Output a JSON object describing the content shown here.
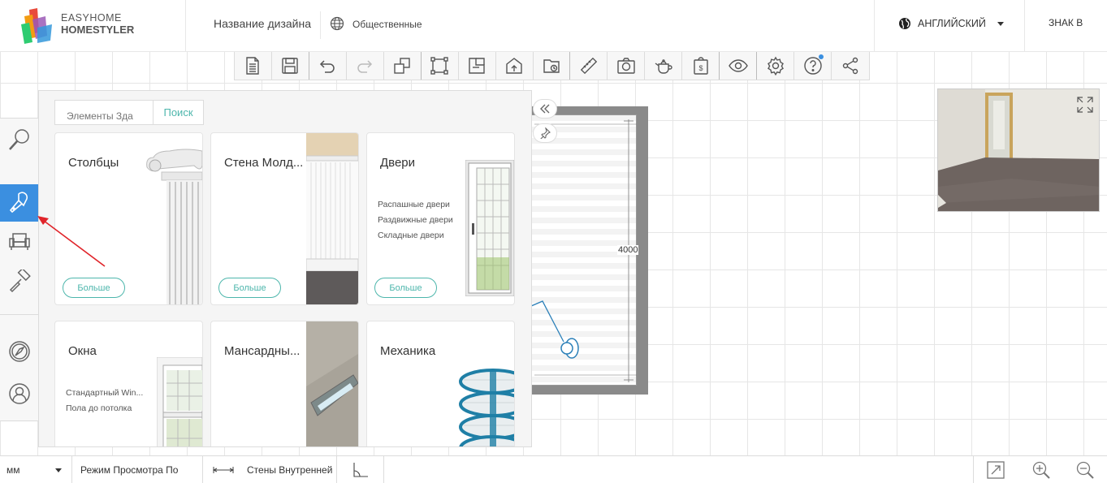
{
  "header": {
    "logo_line1": "EASYHOME",
    "logo_line2": "HOMESTYLER",
    "design_name": "Название дизайна",
    "visibility": "Общественные",
    "language": "АНГЛИЙСКИЙ",
    "sign_in": "ЗНАК В"
  },
  "toolbar": {
    "items": [
      "new-document-icon",
      "save-icon",
      "undo-icon",
      "redo-icon",
      "copy-icon",
      "draw-room-icon",
      "draw-wall-icon",
      "import-icon",
      "open-folder-icon",
      "ruler-icon",
      "camera-icon",
      "teapot-icon",
      "shop-icon",
      "eye-icon",
      "settings-icon",
      "help-icon",
      "share-icon"
    ]
  },
  "left_bar": {
    "items": [
      "search-icon",
      "build-icon",
      "furniture-icon",
      "paint-roller-icon",
      "compass-icon",
      "user-icon"
    ],
    "active": "build-icon"
  },
  "catalog": {
    "search_placeholder": "Элементы Зда",
    "search_button": "Поиск",
    "more_label": "Больше",
    "cards": [
      {
        "title": "Столбцы",
        "subs": []
      },
      {
        "title": "Стена Молд...",
        "subs": []
      },
      {
        "title": "Двери",
        "subs": [
          "Распашные двери",
          "Раздвижные двери",
          "Складные двери"
        ]
      },
      {
        "title": "Окна",
        "subs": [
          "Стандартный Win...",
          "Пола до потолка"
        ]
      },
      {
        "title": "Мансардны...",
        "subs": []
      },
      {
        "title": "Механика",
        "subs": []
      }
    ]
  },
  "canvas": {
    "dimension": "4000"
  },
  "bottom_bar": {
    "unit": "мм",
    "view_mode": "Режим Просмотра По",
    "wall_mode": "Стены Внутренней"
  },
  "colors": {
    "accent": "#3b8fe0",
    "teal": "#4db6ac",
    "arrow": "#e0242a"
  }
}
